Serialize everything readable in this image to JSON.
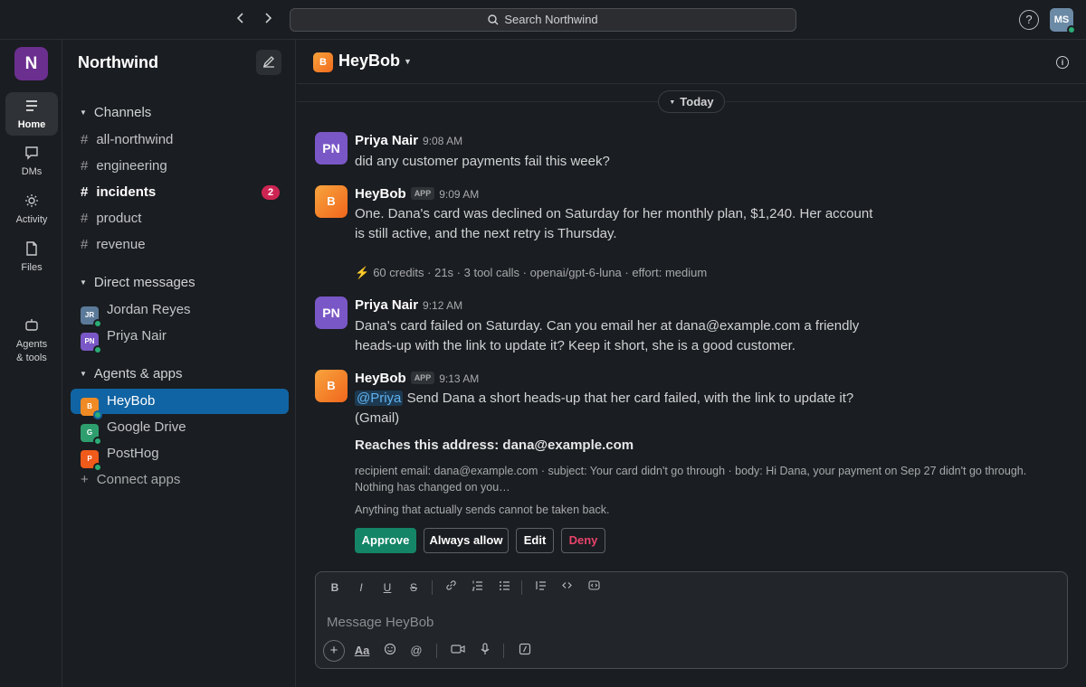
{
  "topbar": {
    "search_placeholder": "Search Northwind",
    "help_label": "?",
    "user_initials": "MS"
  },
  "workspace": {
    "initial": "N",
    "name": "Northwind"
  },
  "rail": {
    "items": [
      {
        "label": "Home",
        "icon": "home-icon",
        "active": true
      },
      {
        "label": "DMs",
        "icon": "dms-icon"
      },
      {
        "label": "Activity",
        "icon": "activity-icon"
      },
      {
        "label": "Files",
        "icon": "files-icon"
      },
      {
        "label": "Agents\n& tools",
        "icon": "agents-icon"
      }
    ]
  },
  "sidebar": {
    "channels_header": "Channels",
    "channels": [
      {
        "name": "all-northwind"
      },
      {
        "name": "engineering"
      },
      {
        "name": "incidents",
        "unread": "2"
      },
      {
        "name": "product"
      },
      {
        "name": "revenue"
      }
    ],
    "dm_header": "Direct messages",
    "dms": [
      {
        "name": "Jordan Reyes",
        "initials": "JR",
        "color": "#5b7a99"
      },
      {
        "name": "Priya Nair",
        "initials": "PN",
        "color": "#7a57c6"
      }
    ],
    "apps_header": "Agents & apps",
    "apps": [
      {
        "name": "HeyBob",
        "initials": "B",
        "color": "#f08a24"
      },
      {
        "name": "Google Drive",
        "initials": "G",
        "color": "#2f9e6e"
      },
      {
        "name": "PostHog",
        "initials": "P",
        "color": "#f05a1a"
      }
    ],
    "connect_label": "Connect apps"
  },
  "channel": {
    "name": "HeyBob",
    "avatar_initial": "B"
  },
  "day_divider": "Today",
  "messages": [
    {
      "author": "Priya Nair",
      "initials": "PN",
      "time": "9:08 AM",
      "text": "did any customer payments fail this week?"
    },
    {
      "author": "HeyBob",
      "initials": "B",
      "app_tag": "APP",
      "time": "9:09 AM",
      "text": "One. Dana's card was declined on Saturday for her monthly plan, $1,240. Her account is still active, and the next retry is Thursday."
    },
    {
      "author": "Priya Nair",
      "initials": "PN",
      "time": "9:12 AM",
      "text": "Dana's card failed on Saturday. Can you email her at dana@example.com a friendly heads-up with the link to update it? Keep it short, she is a good customer."
    },
    {
      "author": "HeyBob",
      "initials": "B",
      "app_tag": "APP",
      "time": "9:13 AM",
      "mention": "@Priya",
      "text": " Send Dana a short heads-up that her card failed, with the link to update it?",
      "text2": "(Gmail)"
    }
  ],
  "meta_line": "60 credits · 21s · 3 tool calls · openai/gpt-6-luna · effort: medium",
  "approval": {
    "title": "Reaches this address: dana@example.com",
    "details": "recipient email: dana@example.com  ·  subject: Your card didn't go through  ·  body: Hi Dana, your payment on Sep 27 didn't go through. Nothing has changed on you…",
    "warning": "Anything that actually sends cannot be taken back.",
    "approve": "Approve",
    "always_allow": "Always allow",
    "edit": "Edit",
    "deny": "Deny"
  },
  "composer": {
    "placeholder": "Message HeyBob",
    "bold": "B",
    "italic": "I",
    "underline": "U",
    "strike": "S",
    "format_label": "Aa",
    "mention_label": "@",
    "plus_label": "+"
  }
}
